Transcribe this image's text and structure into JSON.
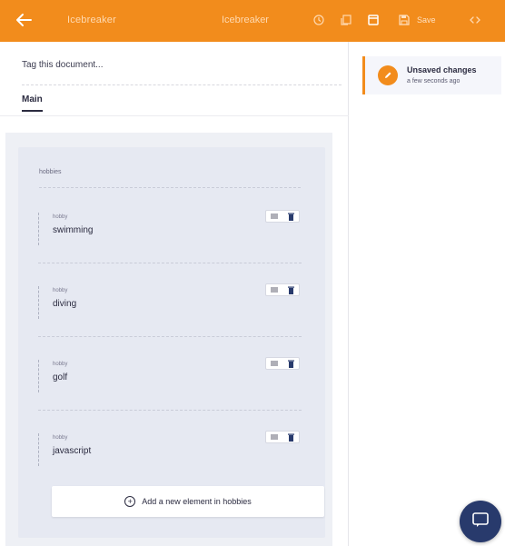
{
  "topbar": {
    "background": "#f28c1c",
    "doc_title": "Icebreaker",
    "center_title": "Icebreaker",
    "save_label": "Save",
    "icons": [
      "back-arrow-icon",
      "history-icon",
      "duplicate-icon",
      "preview-icon",
      "save-icon",
      "code-icon"
    ]
  },
  "document": {
    "tag_placeholder": "Tag this document...",
    "tabs": [
      {
        "label": "Main",
        "active": true
      }
    ]
  },
  "section": {
    "label": "hobbies",
    "items": [
      {
        "label": "hobby",
        "value": "swimming"
      },
      {
        "label": "hobby",
        "value": "diving"
      },
      {
        "label": "hobby",
        "value": "golf"
      },
      {
        "label": "hobby",
        "value": "javascript"
      }
    ],
    "add_label": "Add a new element in hobbies"
  },
  "status": {
    "title": "Unsaved changes",
    "subtitle": "a few seconds ago",
    "accent": "#f28c1c",
    "icon": "pencil-icon"
  },
  "chat": {
    "icon": "chat-icon",
    "color": "#283a6c"
  }
}
